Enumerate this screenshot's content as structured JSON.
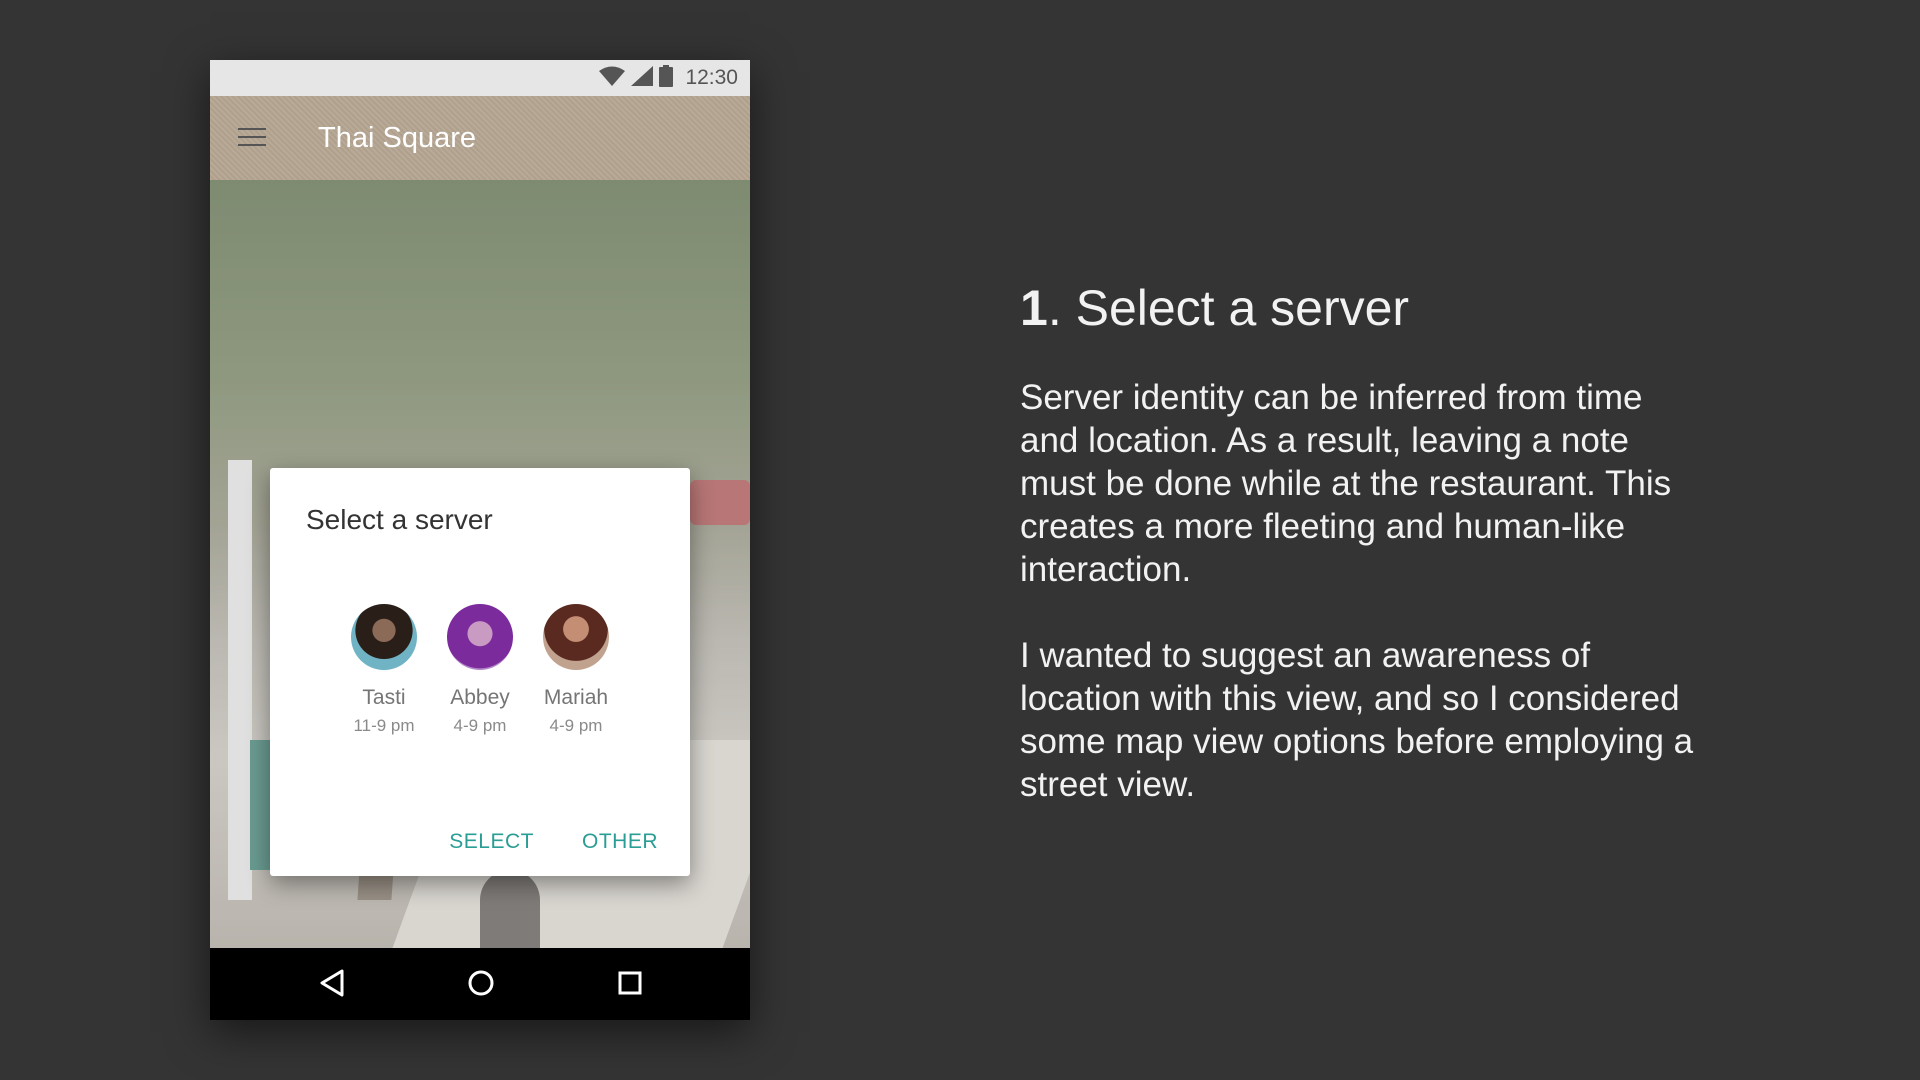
{
  "phone": {
    "status_bar": {
      "time": "12:30",
      "icons": [
        "wifi-icon",
        "signal-icon",
        "battery-icon"
      ]
    },
    "app_bar": {
      "menu_icon": "hamburger-menu-icon",
      "title": "Thai Square"
    },
    "dialog": {
      "title": "Select a server",
      "servers": [
        {
          "name": "Tasti",
          "hours": "11-9 pm"
        },
        {
          "name": "Abbey",
          "hours": "4-9 pm"
        },
        {
          "name": "Mariah",
          "hours": "4-9 pm"
        }
      ],
      "actions": {
        "select": "SELECT",
        "other": "OTHER"
      }
    },
    "nav_bar": {
      "icons": [
        "back-icon",
        "home-icon",
        "recents-icon"
      ]
    }
  },
  "panel": {
    "step_number": "1",
    "step_title": ". Select a server",
    "paragraph_1": "Server identity can be inferred from time and location. As a result, leaving a note must be done while at the restaurant. This creates a more fleeting and human-like interaction.",
    "paragraph_2": "I wanted to suggest an awareness of location with this view, and so I considered some map view options before employing a street view."
  },
  "colors": {
    "background": "#343434",
    "app_bar": "#b5a592",
    "accent": "#2a9d95"
  }
}
